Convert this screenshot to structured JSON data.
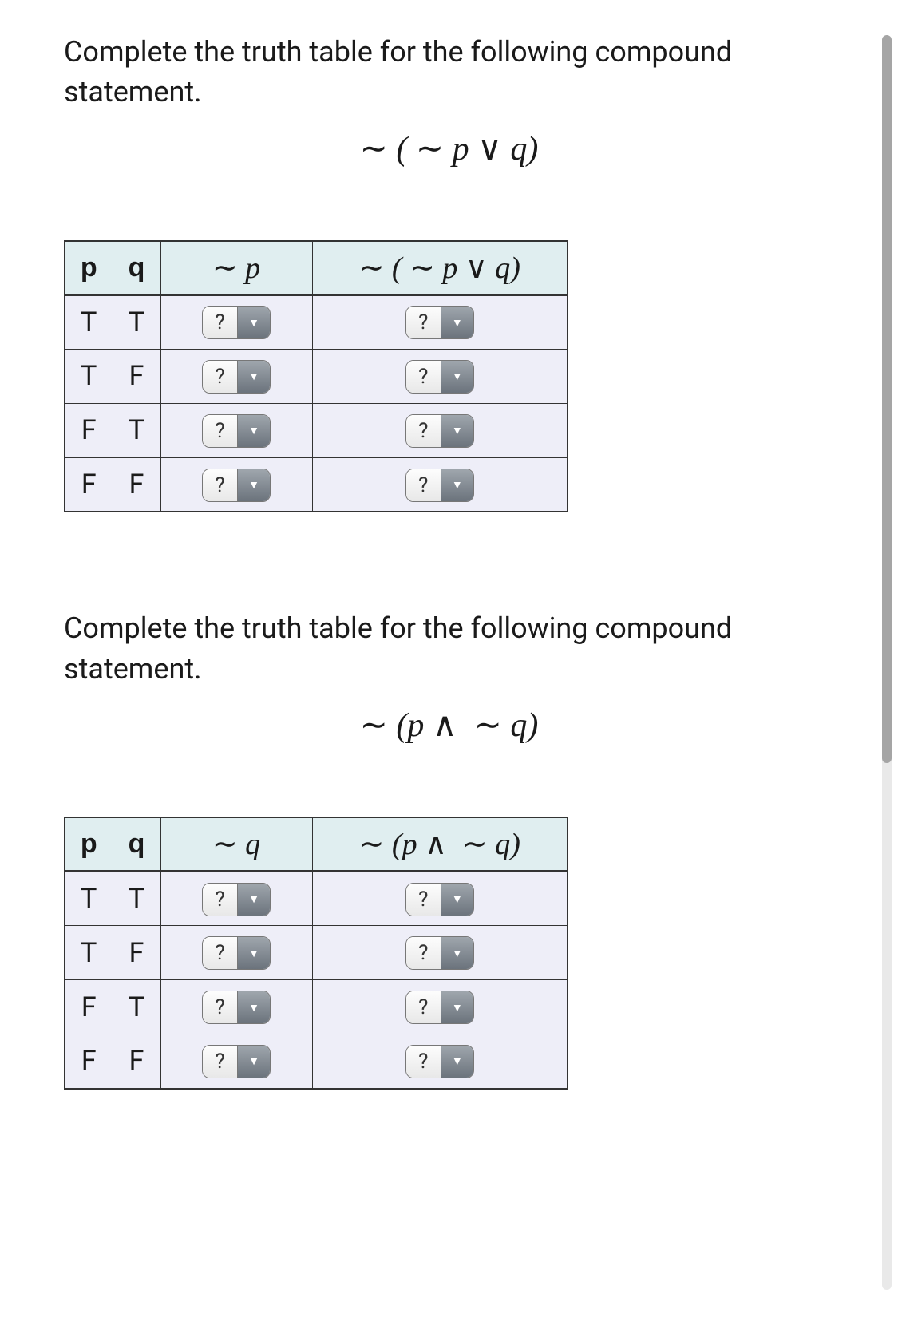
{
  "problem1": {
    "prompt": "Complete the truth table for the following compound statement.",
    "formula_html": "∼ ( ∼ <i>p</i> ∨ <i>q</i>)",
    "headers": {
      "p": "p",
      "q": "q",
      "neg": "∼ p",
      "compound": "∼ ( ∼ p ∨ q)"
    },
    "rows": [
      {
        "p": "T",
        "q": "T",
        "neg_val": "?",
        "compound_val": "?"
      },
      {
        "p": "T",
        "q": "F",
        "neg_val": "?",
        "compound_val": "?"
      },
      {
        "p": "F",
        "q": "T",
        "neg_val": "?",
        "compound_val": "?"
      },
      {
        "p": "F",
        "q": "F",
        "neg_val": "?",
        "compound_val": "?"
      }
    ]
  },
  "problem2": {
    "prompt": "Complete the truth table for the following compound statement.",
    "formula_html": "∼ (<i>p</i> ∧  ∼ <i>q</i>)",
    "headers": {
      "p": "p",
      "q": "q",
      "neg": "∼ q",
      "compound": "∼ (p ∧  ∼ q)"
    },
    "rows": [
      {
        "p": "T",
        "q": "T",
        "neg_val": "?",
        "compound_val": "?"
      },
      {
        "p": "T",
        "q": "F",
        "neg_val": "?",
        "compound_val": "?"
      },
      {
        "p": "F",
        "q": "T",
        "neg_val": "?",
        "compound_val": "?"
      },
      {
        "p": "F",
        "q": "F",
        "neg_val": "?",
        "compound_val": "?"
      }
    ]
  },
  "dropdown_placeholder": "?"
}
